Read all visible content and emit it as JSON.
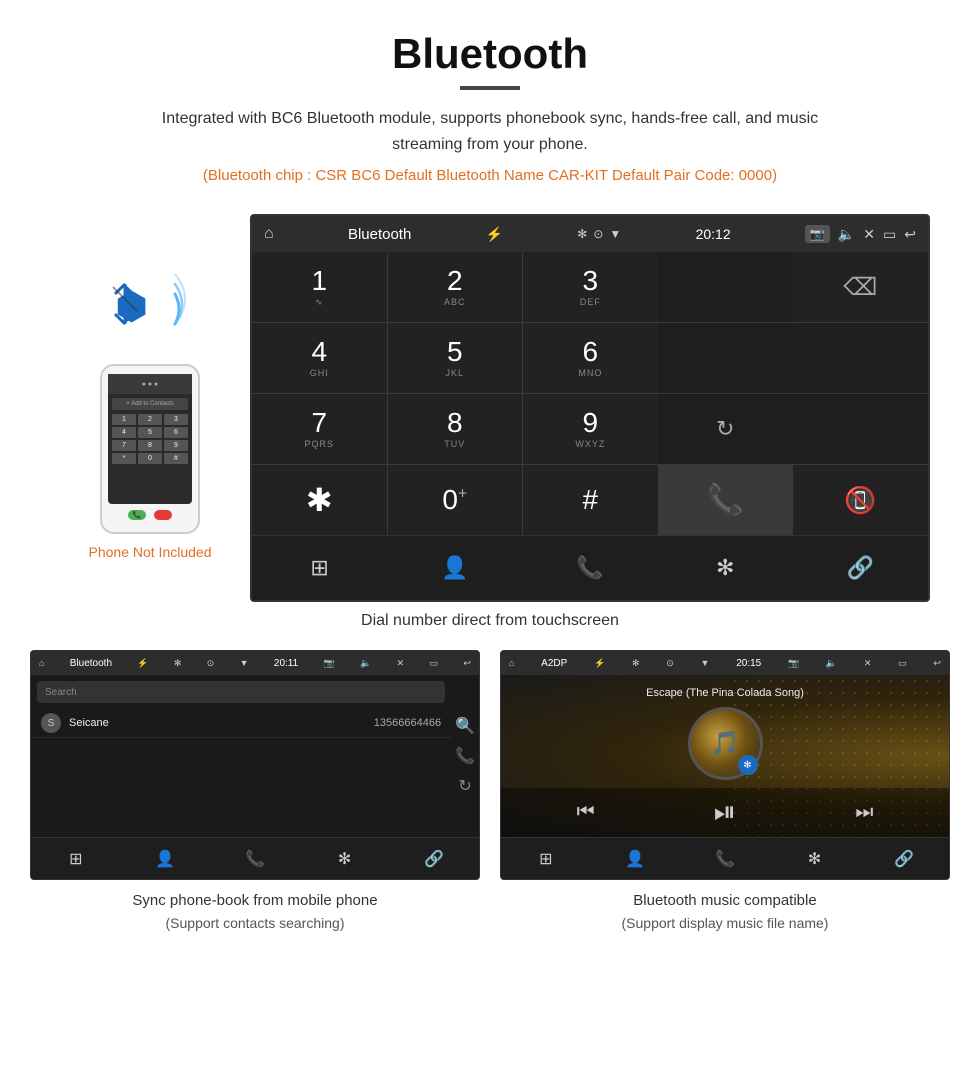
{
  "page": {
    "title": "Bluetooth",
    "description": "Integrated with BC6 Bluetooth module, supports phonebook sync, hands-free call, and music streaming from your phone.",
    "specs": "(Bluetooth chip : CSR BC6    Default Bluetooth Name CAR-KIT    Default Pair Code: 0000)",
    "dial_caption": "Dial number direct from touchscreen",
    "phone_not_included": "Phone Not Included"
  },
  "car_unit_large": {
    "status_bar": {
      "title": "Bluetooth",
      "time": "20:12"
    },
    "dialpad": {
      "keys": [
        {
          "num": "1",
          "letters": "∞",
          "id": "key-1"
        },
        {
          "num": "2",
          "letters": "ABC",
          "id": "key-2"
        },
        {
          "num": "3",
          "letters": "DEF",
          "id": "key-3"
        },
        {
          "num": "4",
          "letters": "GHI",
          "id": "key-4"
        },
        {
          "num": "5",
          "letters": "JKL",
          "id": "key-5"
        },
        {
          "num": "6",
          "letters": "MNO",
          "id": "key-6"
        },
        {
          "num": "7",
          "letters": "PQRS",
          "id": "key-7"
        },
        {
          "num": "8",
          "letters": "TUV",
          "id": "key-8"
        },
        {
          "num": "9",
          "letters": "WXYZ",
          "id": "key-9"
        },
        {
          "num": "*",
          "letters": "",
          "id": "key-star"
        },
        {
          "num": "0",
          "letters": "+",
          "id": "key-0"
        },
        {
          "num": "#",
          "letters": "",
          "id": "key-hash"
        }
      ]
    }
  },
  "phonebook_screen": {
    "status_bar": {
      "title": "Bluetooth",
      "time": "20:11"
    },
    "search_placeholder": "Search",
    "contacts": [
      {
        "initial": "S",
        "name": "Seicane",
        "number": "13566664466"
      }
    ]
  },
  "music_screen": {
    "status_bar": {
      "title": "A2DP",
      "time": "20:15"
    },
    "song_title": "Escape (The Pina Colada Song)"
  },
  "bottom_left_caption": "Sync phone-book from mobile phone",
  "bottom_left_sub": "(Support contacts searching)",
  "bottom_right_caption": "Bluetooth music compatible",
  "bottom_right_sub": "(Support display music file name)",
  "icons": {
    "bluetooth": "ᛒ",
    "home": "⌂",
    "back": "↩",
    "phone_green": "📞",
    "phone_red": "📵",
    "search": "🔍",
    "person": "👤",
    "dialpad_grid": "⊞",
    "prev_track": "⏮",
    "play_pause": "⏯",
    "next_track": "⏭"
  }
}
